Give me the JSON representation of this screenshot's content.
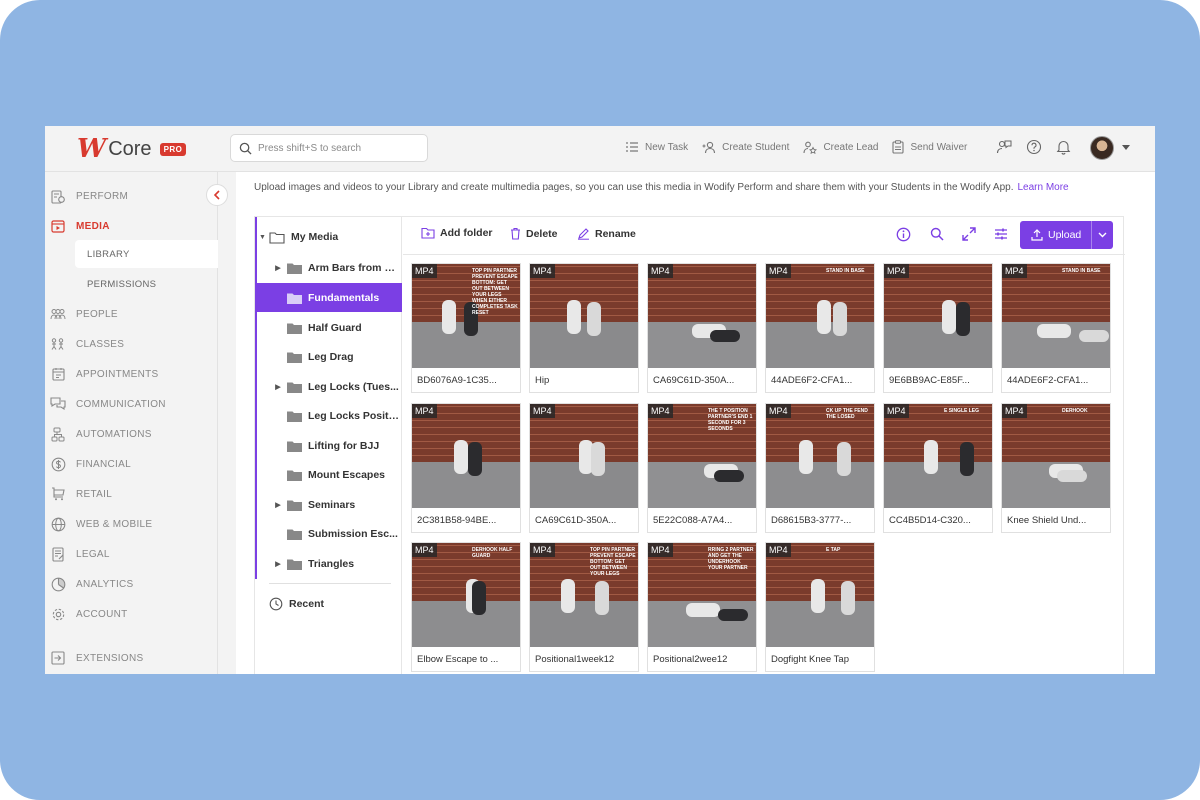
{
  "app": {
    "logo_text": "Core",
    "logo_badge": "PRO"
  },
  "search": {
    "placeholder": "Press shift+S to search"
  },
  "header_actions": [
    {
      "label": "New Task",
      "icon": "task-list-icon"
    },
    {
      "label": "Create Student",
      "icon": "add-person-icon"
    },
    {
      "label": "Create Lead",
      "icon": "lead-star-icon"
    },
    {
      "label": "Send Waiver",
      "icon": "clipboard-icon"
    }
  ],
  "sidebar": {
    "items": [
      {
        "label": "PERFORM",
        "icon": "perform-icon"
      },
      {
        "label": "MEDIA",
        "icon": "media-icon",
        "active": true
      },
      {
        "label": "PEOPLE",
        "icon": "people-icon"
      },
      {
        "label": "CLASSES",
        "icon": "classes-icon"
      },
      {
        "label": "APPOINTMENTS",
        "icon": "calendar-icon"
      },
      {
        "label": "COMMUNICATION",
        "icon": "chat-icon"
      },
      {
        "label": "AUTOMATIONS",
        "icon": "automation-icon"
      },
      {
        "label": "FINANCIAL",
        "icon": "dollar-icon"
      },
      {
        "label": "RETAIL",
        "icon": "cart-icon"
      },
      {
        "label": "WEB & MOBILE",
        "icon": "globe-icon"
      },
      {
        "label": "LEGAL",
        "icon": "legal-icon"
      },
      {
        "label": "ANALYTICS",
        "icon": "analytics-icon"
      },
      {
        "label": "ACCOUNT",
        "icon": "gear-icon"
      }
    ],
    "sub_items": [
      {
        "label": "LIBRARY",
        "selected": true
      },
      {
        "label": "PERMISSIONS"
      }
    ],
    "extensions": "EXTENSIONS"
  },
  "main": {
    "info_text": "Upload images and videos to your Library and create multimedia pages, so you can use this media in Wodify Perform and share them with your Students in the Wodify App.",
    "learn_more": "Learn More"
  },
  "tree": {
    "root": "My Media",
    "folders": [
      {
        "label": "Arm Bars from B...",
        "expandable": true
      },
      {
        "label": "Fundamentals",
        "expandable": false,
        "selected": true
      },
      {
        "label": "Half Guard",
        "expandable": false
      },
      {
        "label": "Leg Drag",
        "expandable": false
      },
      {
        "label": "Leg Locks (Tues...",
        "expandable": true
      },
      {
        "label": "Leg Locks Positi...",
        "expandable": false
      },
      {
        "label": "Lifting for BJJ",
        "expandable": false
      },
      {
        "label": "Mount Escapes",
        "expandable": false
      },
      {
        "label": "Seminars",
        "expandable": true
      },
      {
        "label": "Submission Esc...",
        "expandable": false
      },
      {
        "label": "Triangles",
        "expandable": true
      }
    ],
    "recent": "Recent"
  },
  "toolbar": {
    "add_folder": "Add folder",
    "delete": "Delete",
    "rename": "Rename",
    "upload": "Upload"
  },
  "media": [
    {
      "badge": "MP4",
      "name": "BD6076A9-1C35...",
      "overlay": "TOP PIN PARTNER PREVENT ESCAPE BOTTOM: GET OUT BETWEEN YOUR LEGS WHEN EITHER COMPLETES TASK RESET"
    },
    {
      "badge": "MP4",
      "name": "Hip",
      "overlay": ""
    },
    {
      "badge": "MP4",
      "name": "CA69C61D-350A...",
      "overlay": ""
    },
    {
      "badge": "MP4",
      "name": "44ADE6F2-CFA1...",
      "overlay": "STAND IN BASE"
    },
    {
      "badge": "MP4",
      "name": "9E6BB9AC-E85F...",
      "overlay": ""
    },
    {
      "badge": "MP4",
      "name": "44ADE6F2-CFA1...",
      "overlay": "STAND IN BASE"
    },
    {
      "badge": "MP4",
      "name": "2C381B58-94BE...",
      "overlay": ""
    },
    {
      "badge": "MP4",
      "name": "CA69C61D-350A...",
      "overlay": ""
    },
    {
      "badge": "MP4",
      "name": "5E22C088-A7A4...",
      "overlay": "THE T POSITION PARTNER'S END 1 SECOND FOR 3 SECONDS"
    },
    {
      "badge": "MP4",
      "name": "D68615B3-3777-...",
      "overlay": "CK UP THE FEND THE LOSED"
    },
    {
      "badge": "MP4",
      "name": "CC4B5D14-C320...",
      "overlay": "E SINGLE LEG"
    },
    {
      "badge": "MP4",
      "name": "Knee Shield Und...",
      "overlay": "DERHOOK"
    },
    {
      "badge": "MP4",
      "name": "Elbow Escape to ...",
      "overlay": "DERHOOK HALF GUARD"
    },
    {
      "badge": "MP4",
      "name": "Positional1week12",
      "overlay": "TOP PIN PARTNER PREVENT ESCAPE BOTTOM: GET OUT BETWEEN YOUR LEGS"
    },
    {
      "badge": "MP4",
      "name": "Positional2wee12",
      "overlay": "RRING 2 PARTNER AND GET THE UNDERHOOK YOUR PARTNER"
    },
    {
      "badge": "MP4",
      "name": "Dogfight Knee Tap",
      "overlay": "E TAP"
    }
  ]
}
